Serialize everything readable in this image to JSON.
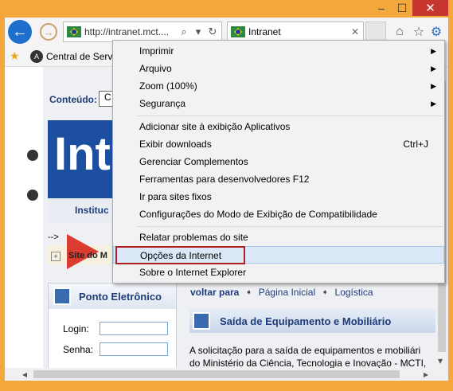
{
  "window": {
    "buttons": {
      "minimize": "–",
      "maximize": "☐",
      "close": "✕"
    }
  },
  "toolbar": {
    "address": "http://intranet.mct....",
    "tab_title": "Intranet",
    "tab_close": "✕"
  },
  "favorites": {
    "item_label": "Central de Servi"
  },
  "page": {
    "conteudo_label": "Conteúdo:",
    "conteudo_value": "C",
    "banner_text": "Int",
    "institucional": "Instituc",
    "arrow_text": "-->",
    "site_do_mcti": "Site do M",
    "ponto_title": "Ponto Eletrônico",
    "login_label": "Login:",
    "senha_label": "Senha:",
    "voltar_label": "voltar para",
    "link_pagina_inicial": "Página Inicial",
    "link_logistica": "Logística",
    "section_title": "Saída de Equipamento e Mobiliário",
    "paragraph_line1": "A solicitação para a saída de equipamentos e mobiliári",
    "paragraph_line2": "do Ministério da Ciência, Tecnologia e Inovação - MCTI,"
  },
  "menu": {
    "items": [
      {
        "label": "Imprimir",
        "submenu": true
      },
      {
        "label": "Arquivo",
        "submenu": true
      },
      {
        "label": "Zoom (100%)",
        "submenu": true
      },
      {
        "label": "Segurança",
        "submenu": true
      },
      {
        "label": "Adicionar site à exibição Aplicativos"
      },
      {
        "label": "Exibir downloads",
        "shortcut": "Ctrl+J"
      },
      {
        "label": "Gerenciar Complementos"
      },
      {
        "label": "Ferramentas para desenvolvedores F12"
      },
      {
        "label": "Ir para sites fixos"
      },
      {
        "label": "Configurações do Modo de Exibição de Compatibilidade"
      },
      {
        "label": "Relatar problemas do site"
      },
      {
        "label": "Opções da Internet",
        "highlighted": true
      },
      {
        "label": "Sobre o Internet Explorer"
      }
    ]
  }
}
